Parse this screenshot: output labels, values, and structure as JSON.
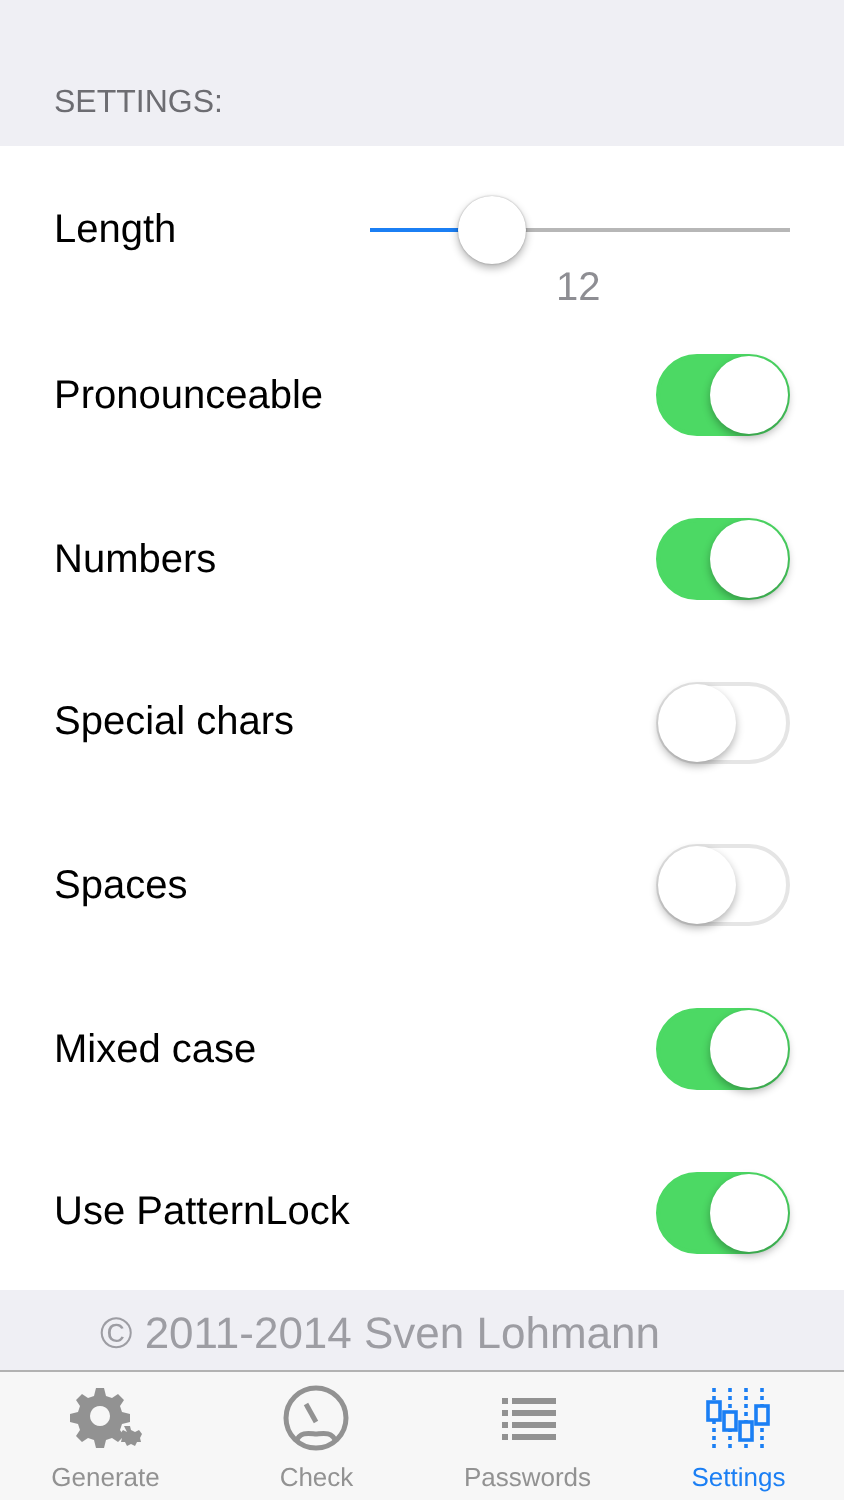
{
  "section_header": "SETTINGS:",
  "length": {
    "label": "Length",
    "level": 0.29,
    "reading": "12"
  },
  "toggles": [
    {
      "label": "Pronounceable",
      "on": true
    },
    {
      "label": "Numbers",
      "on": true
    },
    {
      "label": "Special chars",
      "on": false
    },
    {
      "label": "Spaces",
      "on": false
    },
    {
      "label": "Mixed case",
      "on": true
    },
    {
      "label": "Use PatternLock",
      "on": true
    }
  ],
  "footer": "© 2011-2014 Sven Lohmann",
  "tab_bar": [
    {
      "label": "Generate",
      "selected": false
    },
    {
      "label": "Check",
      "selected": false
    },
    {
      "label": "Passwords",
      "selected": false
    },
    {
      "label": "Settings",
      "selected": true
    }
  ]
}
